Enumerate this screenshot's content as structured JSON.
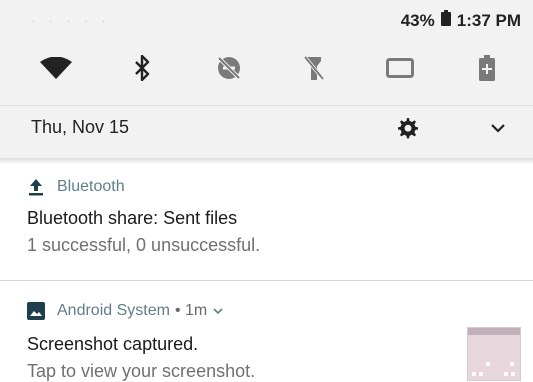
{
  "status_bar": {
    "carrier_text": ". .  . .  .",
    "battery_percent": "43%",
    "time": "1:37 PM"
  },
  "quick_settings": {
    "tiles": [
      {
        "icon": "wifi-icon",
        "state": "on"
      },
      {
        "icon": "bluetooth-icon",
        "state": "on"
      },
      {
        "icon": "do-not-disturb-off-icon",
        "state": "off"
      },
      {
        "icon": "flashlight-off-icon",
        "state": "off"
      },
      {
        "icon": "screen-cast-icon",
        "state": "off"
      },
      {
        "icon": "battery-saver-icon",
        "state": "off"
      }
    ],
    "date": "Thu, Nov 15"
  },
  "notifications": [
    {
      "app": "Bluetooth",
      "icon": "upload-icon",
      "title": "Bluetooth share: Sent files",
      "text": "1 successful, 0 unsuccessful."
    },
    {
      "app": "Android System",
      "icon": "image-icon",
      "meta": "• 1m",
      "title": "Screenshot captured.",
      "text": "Tap to view your screenshot."
    }
  ],
  "colors": {
    "shade_bg": "#f2f2f2",
    "app_label": "#5f7f8a",
    "icon_active": "#222222",
    "icon_inactive": "#7a7a7a"
  }
}
